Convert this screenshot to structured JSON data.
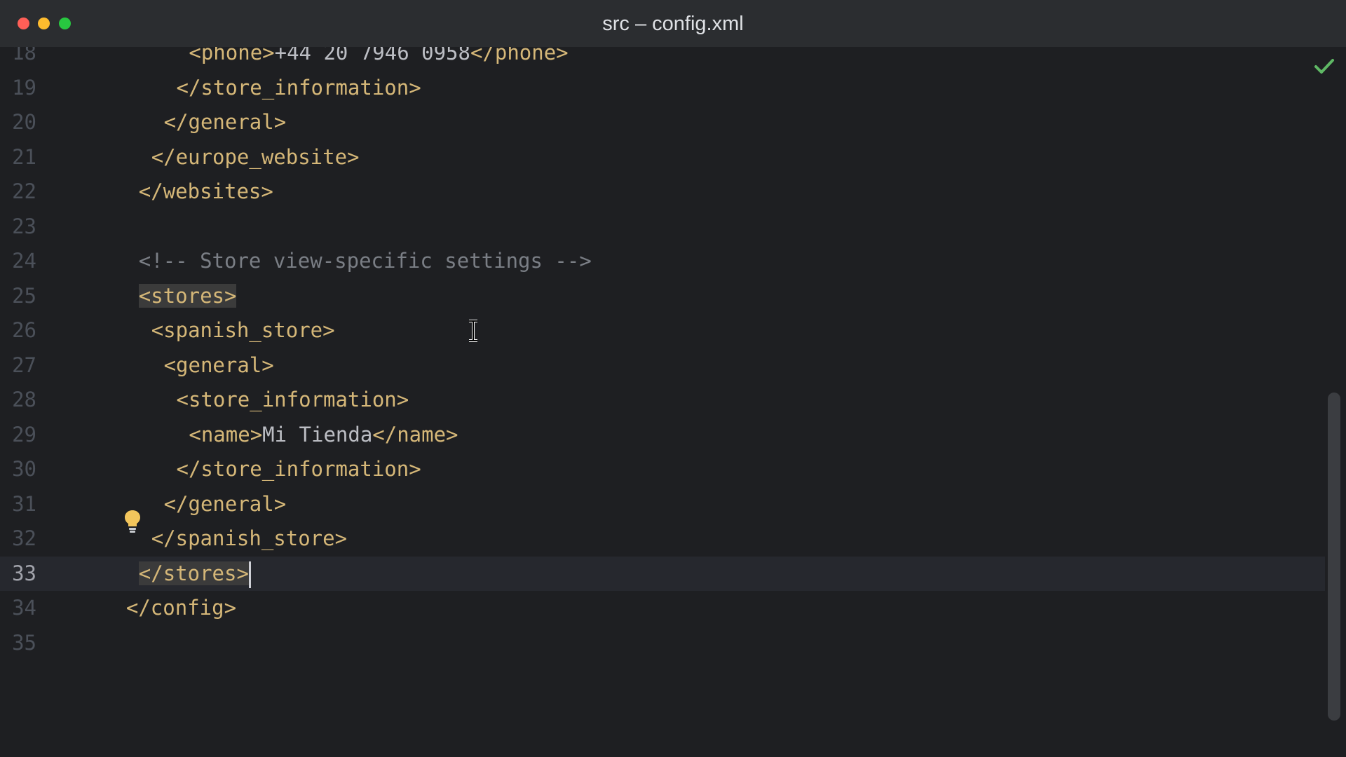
{
  "window": {
    "title": "src – config.xml"
  },
  "editor": {
    "lines": [
      {
        "num": "18",
        "indent": 24,
        "parts": [
          {
            "c": "tag",
            "t": "<phone>"
          },
          {
            "c": "txt",
            "t": "+44 20 7946 0958"
          },
          {
            "c": "tag",
            "t": "</phone>"
          }
        ]
      },
      {
        "num": "19",
        "indent": 20,
        "parts": [
          {
            "c": "tag",
            "t": "</store_information>"
          }
        ]
      },
      {
        "num": "20",
        "indent": 16,
        "parts": [
          {
            "c": "tag",
            "t": "</general>"
          }
        ]
      },
      {
        "num": "21",
        "indent": 12,
        "parts": [
          {
            "c": "tag",
            "t": "</europe_website>"
          }
        ]
      },
      {
        "num": "22",
        "indent": 8,
        "parts": [
          {
            "c": "tag",
            "t": "</websites>"
          }
        ]
      },
      {
        "num": "23",
        "indent": 0,
        "parts": []
      },
      {
        "num": "24",
        "indent": 8,
        "parts": [
          {
            "c": "cmt",
            "t": "<!-- Store view-specific settings -->"
          }
        ]
      },
      {
        "num": "25",
        "indent": 8,
        "parts": [
          {
            "c": "tag hl",
            "t": "<stores>"
          }
        ]
      },
      {
        "num": "26",
        "indent": 12,
        "parts": [
          {
            "c": "tag",
            "t": "<spanish_store>"
          }
        ]
      },
      {
        "num": "27",
        "indent": 16,
        "parts": [
          {
            "c": "tag",
            "t": "<general>"
          }
        ]
      },
      {
        "num": "28",
        "indent": 20,
        "parts": [
          {
            "c": "tag",
            "t": "<store_information>"
          }
        ]
      },
      {
        "num": "29",
        "indent": 24,
        "parts": [
          {
            "c": "tag",
            "t": "<name>"
          },
          {
            "c": "txt",
            "t": "Mi Tienda"
          },
          {
            "c": "tag",
            "t": "</name>"
          }
        ]
      },
      {
        "num": "30",
        "indent": 20,
        "parts": [
          {
            "c": "tag",
            "t": "</store_information>"
          }
        ]
      },
      {
        "num": "31",
        "indent": 16,
        "parts": [
          {
            "c": "tag",
            "t": "</general>"
          }
        ]
      },
      {
        "num": "32",
        "indent": 12,
        "parts": [
          {
            "c": "tag",
            "t": "</spanish_store>"
          }
        ]
      },
      {
        "num": "33",
        "indent": 8,
        "current": true,
        "caret": true,
        "parts": [
          {
            "c": "tag hl",
            "t": "</stores>"
          }
        ]
      },
      {
        "num": "34",
        "indent": 4,
        "parts": [
          {
            "c": "tag",
            "t": "</config>"
          }
        ]
      },
      {
        "num": "35",
        "indent": 0,
        "parts": []
      }
    ]
  },
  "icons": {
    "intention_bulb": "lightbulb-icon",
    "inspection_status": "checkmark-icon",
    "cursor": "text-cursor-icon"
  },
  "colors": {
    "background": "#1e1f22",
    "titlebar": "#2b2d30",
    "tag": "#d5b778",
    "comment": "#7a7e85",
    "text": "#bcbec4",
    "line_number": "#4b5059",
    "check": "#5fb865",
    "bulb": "#f2c55c"
  }
}
